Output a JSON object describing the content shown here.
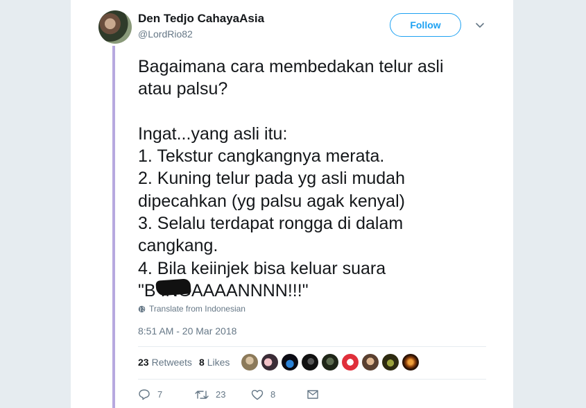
{
  "tweet": {
    "author_name": "Den Tedjo CahayaAsia",
    "author_handle": "@LordRio82",
    "follow_label": "Follow",
    "text": "Bagaimana cara membedakan telur asli\natau palsu?\n\nIngat...yang asli itu:\n1. Tekstur cangkangnya merata.\n2. Kuning telur pada yg asli mudah\ndipecahkan (yg palsu agak kenyal)\n3. Selalu terdapat rongga di dalam\ncangkang.\n4. Bila keiinjek bisa keluar suara\n\"B          INGAAAANNNN!!!\"",
    "translate_label": "Translate from Indonesian",
    "timestamp": "8:51 AM - 20 Mar 2018"
  },
  "stats": {
    "retweets_count": "23",
    "retweets_label": "Retweets",
    "likes_count": "8",
    "likes_label": "Likes"
  },
  "actions": {
    "reply_count": "7",
    "retweet_count": "23",
    "like_count": "8"
  },
  "colors": {
    "accent": "#1da1f2",
    "thread_line": "#b7a9df",
    "text_primary": "#14171a",
    "text_secondary": "#657786"
  },
  "icons": [
    "globe-icon",
    "chevron-down-icon",
    "reply-icon",
    "retweet-icon",
    "heart-icon",
    "message-icon"
  ]
}
